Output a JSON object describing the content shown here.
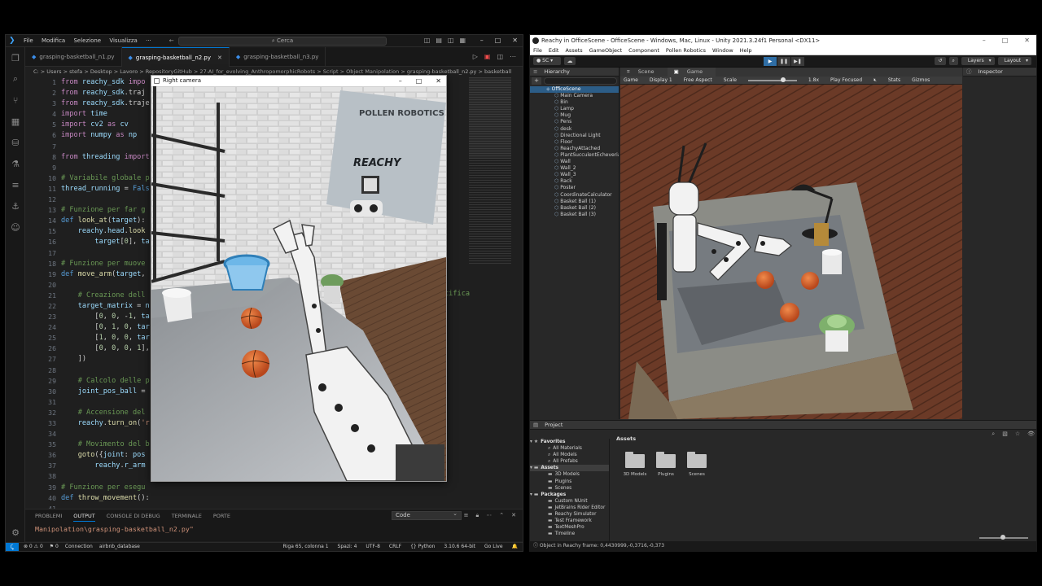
{
  "vscode": {
    "menu": [
      "File",
      "Modifica",
      "Selezione",
      "Visualizza",
      "···"
    ],
    "search_placeholder": "Cerca",
    "tabs": [
      {
        "label": "grasping-basketball_n1.py",
        "active": false
      },
      {
        "label": "grasping-basketball_n2.py",
        "active": true
      },
      {
        "label": "grasping-basketball_n3.py",
        "active": false
      }
    ],
    "breadcrumb": "C: > Users > stefa > Desktop > Lavoro > RepositoryGitHub > 27-AI_for_evolving_AnthropomorphicRobots > Script > Object Manipolation > grasping-basketball_n2.py > basketball",
    "line_numbers": [
      "1",
      "2",
      "3",
      "4",
      "5",
      "6",
      "7",
      "8",
      "9",
      "10",
      "11",
      "12",
      "13",
      "14",
      "15",
      "16",
      "17",
      "18",
      "19",
      "20",
      "21",
      "22",
      "23",
      "24",
      "25",
      "26",
      "27",
      "28",
      "29",
      "30",
      "31",
      "32",
      "33",
      "34",
      "35",
      "36",
      "37",
      "38",
      "39",
      "40",
      "41"
    ],
    "overflow_comment": "cifica",
    "panel_tabs": [
      "PROBLEMI",
      "OUTPUT",
      "CONSOLE DI DEBUG",
      "TERMINALE",
      "PORTE"
    ],
    "panel_active_tab": "OUTPUT",
    "output_filter": "Code",
    "output_text": "Manipolation\\grasping-basketball_n2.py\"",
    "status_left": [
      "⊗ 0 ⚠ 0",
      "⚑ 0",
      "Connection",
      "airbnb_database"
    ],
    "status_right": [
      "Riga 65, colonna 1",
      "Spazi: 4",
      "UTF-8",
      "CRLF",
      "{} Python",
      "3.10.6 64-bit",
      "Go Live",
      "🔔"
    ]
  },
  "camera_window": {
    "title": "Right camera",
    "poster_brand": "POLLEN ROBOTICS",
    "poster_word": "REACHY"
  },
  "unity": {
    "title": "Reachy in OfficeScene - OfficeScene - Windows, Mac, Linux - Unity 2021.3.24f1 Personal <DX11>",
    "menu": [
      "File",
      "Edit",
      "Assets",
      "GameObject",
      "Component",
      "Pollen Robotics",
      "Window",
      "Help"
    ],
    "account": "SC",
    "layers": "Layers",
    "layout": "Layout",
    "hierarchy_title": "Hierarchy",
    "scene_root": "OfficeScene",
    "hierarchy_items": [
      "Main Camera",
      "Bin",
      "Lamp",
      "Mug",
      "Pens",
      "desk",
      "Directional Light",
      "Floor",
      "ReachyAttached",
      "PlantSucculentEcheveria",
      "Wall",
      "Wall_2",
      "Wall_3",
      "Rack",
      "Poster",
      "CoordinateCalculator",
      "Basket Ball (1)",
      "Basket Ball (2)",
      "Basket Ball (3)"
    ],
    "view_tabs": [
      "Scene",
      "Game"
    ],
    "game_bar": [
      "Game",
      "Display 1",
      "Free Aspect",
      "Scale",
      "1.8x",
      "Play Focused",
      "Stats",
      "Gizmos"
    ],
    "inspector_title": "Inspector",
    "project_title": "Project",
    "favorites": "Favorites",
    "favorite_items": [
      "All Materials",
      "All Models",
      "All Prefabs"
    ],
    "assets_label": "Assets",
    "asset_items": [
      "3D Models",
      "Plugins",
      "Scenes"
    ],
    "packages_label": "Packages",
    "package_items": [
      "Custom NUnit",
      "JetBrains Rider Editor",
      "Reachy Simulator",
      "Test Framework",
      "TextMeshPro",
      "Timeline"
    ],
    "asset_folders": [
      "3D Models",
      "Plugins",
      "Scenes"
    ],
    "status_text": "ⓘ Object in Reachy frame: 0,4430999,-0,3716,-0,373"
  }
}
